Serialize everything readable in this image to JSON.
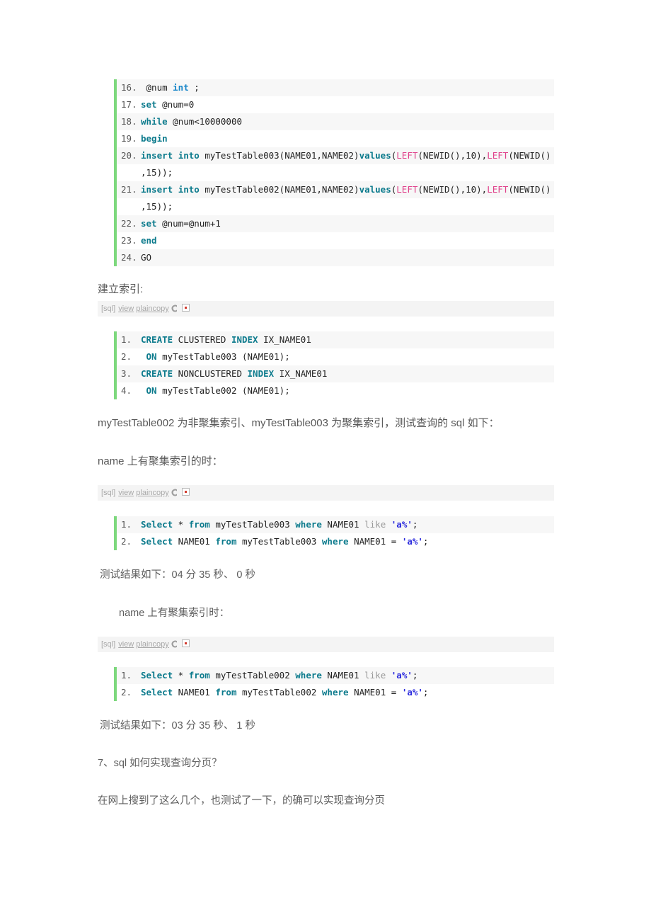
{
  "document": {
    "language": "zh-CN",
    "theme": {
      "accent_green": "#7dd87d",
      "keyword_teal": "#0b7a8c",
      "keyword_blue": "#1a87c9",
      "function_pink": "#e0408a",
      "string_blue": "#2b2bdd",
      "row_alt_bg": "#f7f7f7",
      "toolbar_bg": "#f4f4f4",
      "body_text": "#5e5e5e"
    }
  },
  "toolbar": {
    "tag": "[sql]",
    "view_label": "view",
    "plaincopy_label": "plaincopy",
    "copy_icon": "copy-icon",
    "print_icon": "print-icon"
  },
  "code_block_1": {
    "language": "sql",
    "lines": [
      {
        "n": "16.",
        "tokens": [
          {
            "t": "plain",
            "v": "      @num "
          },
          {
            "t": "kw2",
            "v": "int"
          },
          {
            "t": "plain",
            "v": " ;"
          }
        ]
      },
      {
        "n": "17.",
        "tokens": [
          {
            "t": "kw",
            "v": "set"
          },
          {
            "t": "plain",
            "v": " @num=0"
          }
        ]
      },
      {
        "n": "18.",
        "tokens": [
          {
            "t": "kw",
            "v": "while"
          },
          {
            "t": "plain",
            "v": " @num<10000000"
          }
        ]
      },
      {
        "n": "19.",
        "tokens": [
          {
            "t": "kw",
            "v": "begin"
          }
        ]
      },
      {
        "n": "20.",
        "tokens": [
          {
            "t": "kw",
            "v": "insert"
          },
          {
            "t": "plain",
            "v": " "
          },
          {
            "t": "kw",
            "v": "into"
          },
          {
            "t": "plain",
            "v": " myTestTable003(NAME01,NAME02)"
          },
          {
            "t": "kw",
            "v": "values"
          },
          {
            "t": "plain",
            "v": "("
          },
          {
            "t": "fn",
            "v": "LEFT"
          },
          {
            "t": "plain",
            "v": "(NEWID(),10),"
          },
          {
            "t": "fn",
            "v": "LEFT"
          },
          {
            "t": "plain",
            "v": "(NEWID()"
          }
        ]
      },
      {
        "n": "",
        "tokens": [
          {
            "t": "plain",
            "v": ",15));"
          }
        ]
      },
      {
        "n": "21.",
        "tokens": [
          {
            "t": "kw",
            "v": "insert"
          },
          {
            "t": "plain",
            "v": " "
          },
          {
            "t": "kw",
            "v": "into"
          },
          {
            "t": "plain",
            "v": " myTestTable002(NAME01,NAME02)"
          },
          {
            "t": "kw",
            "v": "values"
          },
          {
            "t": "plain",
            "v": "("
          },
          {
            "t": "fn",
            "v": "LEFT"
          },
          {
            "t": "plain",
            "v": "(NEWID(),10),"
          },
          {
            "t": "fn",
            "v": "LEFT"
          },
          {
            "t": "plain",
            "v": "(NEWID()"
          }
        ]
      },
      {
        "n": "",
        "tokens": [
          {
            "t": "plain",
            "v": ",15));"
          }
        ]
      },
      {
        "n": "22.",
        "tokens": [
          {
            "t": "kw",
            "v": "set"
          },
          {
            "t": "plain",
            "v": " @num=@num+1"
          }
        ]
      },
      {
        "n": "23.",
        "tokens": [
          {
            "t": "kw",
            "v": "end"
          }
        ]
      },
      {
        "n": "24.",
        "tokens": [
          {
            "t": "plain",
            "v": "GO"
          }
        ]
      }
    ]
  },
  "heading_create_index": "建立索引:",
  "code_block_2": {
    "language": "sql",
    "lines": [
      {
        "n": "1.",
        "tokens": [
          {
            "t": "kw",
            "v": "CREATE"
          },
          {
            "t": "plain",
            "v": " CLUSTERED "
          },
          {
            "t": "kw",
            "v": "INDEX"
          },
          {
            "t": "plain",
            "v": " IX_NAME01"
          }
        ]
      },
      {
        "n": "2.",
        "tokens": [
          {
            "t": "plain",
            "v": "    "
          },
          {
            "t": "kw",
            "v": "ON"
          },
          {
            "t": "plain",
            "v": " myTestTable003 (NAME01);"
          }
        ]
      },
      {
        "n": "3.",
        "tokens": [
          {
            "t": "kw",
            "v": "CREATE"
          },
          {
            "t": "plain",
            "v": " NONCLUSTERED "
          },
          {
            "t": "kw",
            "v": "INDEX"
          },
          {
            "t": "plain",
            "v": " IX_NAME01"
          }
        ]
      },
      {
        "n": "4.",
        "tokens": [
          {
            "t": "plain",
            "v": "    "
          },
          {
            "t": "kw",
            "v": "ON"
          },
          {
            "t": "plain",
            "v": " myTestTable002 (NAME01);"
          }
        ]
      }
    ]
  },
  "paragraph_index_types": "myTestTable002 为非聚集索引、myTestTable003 为聚集索引，测试查询的 sql 如下：",
  "paragraph_clustered_when": "name 上有聚集索引的时：",
  "code_block_3": {
    "language": "sql",
    "lines": [
      {
        "n": "1.",
        "tokens": [
          {
            "t": "kw",
            "v": "Select"
          },
          {
            "t": "plain",
            "v": " * "
          },
          {
            "t": "kw",
            "v": "from"
          },
          {
            "t": "plain",
            "v": "  myTestTable003  "
          },
          {
            "t": "kw",
            "v": "where"
          },
          {
            "t": "plain",
            "v": " NAME01 "
          },
          {
            "t": "dim",
            "v": "like"
          },
          {
            "t": "plain",
            "v": " "
          },
          {
            "t": "str",
            "v": "'a%'"
          },
          {
            "t": "plain",
            "v": ";"
          }
        ]
      },
      {
        "n": "2.",
        "tokens": [
          {
            "t": "kw",
            "v": "Select"
          },
          {
            "t": "plain",
            "v": " NAME01 "
          },
          {
            "t": "kw",
            "v": "from"
          },
          {
            "t": "plain",
            "v": "  myTestTable003  "
          },
          {
            "t": "kw",
            "v": "where"
          },
          {
            "t": "plain",
            "v": " NAME01 =  "
          },
          {
            "t": "str",
            "v": "'a%'"
          },
          {
            "t": "plain",
            "v": ";"
          }
        ]
      }
    ]
  },
  "result_1": "测试结果如下：04 分 35 秒、 0 秒",
  "paragraph_nonclustered_when": "name 上有聚集索引时：",
  "code_block_4": {
    "language": "sql",
    "lines": [
      {
        "n": "1.",
        "tokens": [
          {
            "t": "kw",
            "v": "Select"
          },
          {
            "t": "plain",
            "v": " * "
          },
          {
            "t": "kw",
            "v": "from"
          },
          {
            "t": "plain",
            "v": "  myTestTable002  "
          },
          {
            "t": "kw",
            "v": "where"
          },
          {
            "t": "plain",
            "v": " NAME01 "
          },
          {
            "t": "dim",
            "v": "like"
          },
          {
            "t": "plain",
            "v": " "
          },
          {
            "t": "str",
            "v": "'a%'"
          },
          {
            "t": "plain",
            "v": ";"
          }
        ]
      },
      {
        "n": "2.",
        "tokens": [
          {
            "t": "kw",
            "v": "Select"
          },
          {
            "t": "plain",
            "v": " NAME01 "
          },
          {
            "t": "kw",
            "v": "from"
          },
          {
            "t": "plain",
            "v": "  myTestTable002  "
          },
          {
            "t": "kw",
            "v": "where"
          },
          {
            "t": "plain",
            "v": " NAME01 =  "
          },
          {
            "t": "str",
            "v": "'a%'"
          },
          {
            "t": "plain",
            "v": ";"
          }
        ]
      }
    ]
  },
  "result_2": "测试结果如下：03 分 35 秒、 1 秒",
  "question_7": "7、sql 如何实现查询分页？",
  "paragraph_found_online": "在网上搜到了这么几个，也测试了一下，的确可以实现查询分页"
}
